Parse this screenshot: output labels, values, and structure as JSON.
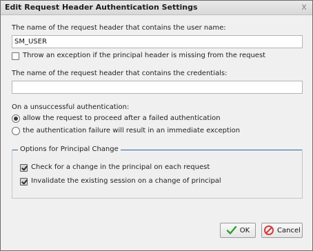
{
  "dialog": {
    "title": "Edit Request Header Authentication Settings",
    "close_glyph": "x"
  },
  "fields": {
    "user_header_label": "The name of the request header that contains the user name:",
    "user_header_value": "SM_USER",
    "throw_exception_label": "Throw an exception if the principal header is missing from the request",
    "throw_exception_checked": false,
    "credentials_header_label": "The name of the request header that contains the credentials:",
    "credentials_header_value": ""
  },
  "unsuccessful": {
    "label": "On a unsuccessful authentication:",
    "options": [
      {
        "label": "allow the request to proceed after a failed authentication",
        "selected": true
      },
      {
        "label": "the authentication failure will result in an immediate exception",
        "selected": false
      }
    ]
  },
  "principal_change": {
    "legend": "Options for Principal Change",
    "options": [
      {
        "label": "Check for a change in the principal on each request",
        "checked": true
      },
      {
        "label": "Invalidate the existing session on a change of principal",
        "checked": true
      }
    ],
    "accent": "#2f5da8"
  },
  "buttons": {
    "ok_label": "OK",
    "ok_icon": "checkmark-icon",
    "cancel_label": "Cancel",
    "cancel_icon": "cancel-icon"
  },
  "colors": {
    "ok_check": "#2e9e2e",
    "cancel_red": "#d23b3b"
  }
}
